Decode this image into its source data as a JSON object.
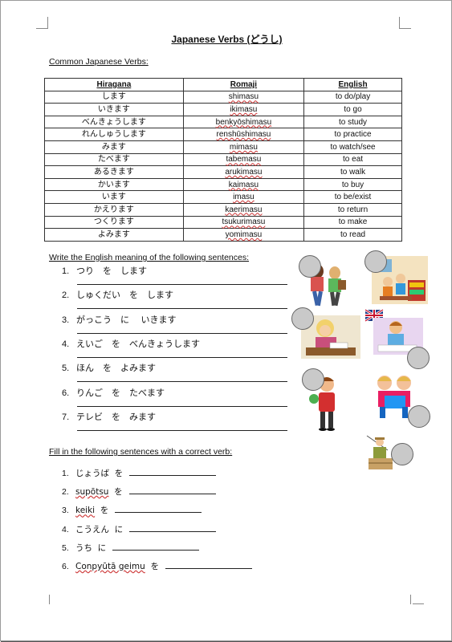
{
  "title": "Japanese Verbs (どうし)",
  "table_heading": "Common Japanese Verbs:",
  "table": {
    "headers": [
      "Hiragana",
      "Romaji",
      "English"
    ],
    "rows": [
      [
        "します",
        "shimasu",
        "to do/play"
      ],
      [
        "いきます",
        "ikimasu",
        "to go"
      ],
      [
        "べんきょうします",
        "benkyōshimasu",
        "to study"
      ],
      [
        "れんしゅうします",
        "renshūshimasu",
        "to practice"
      ],
      [
        "みます",
        "mimasu",
        "to watch/see"
      ],
      [
        "たべます",
        "tabemasu",
        "to eat"
      ],
      [
        "あるきます",
        "arukimasu",
        "to walk"
      ],
      [
        "かいます",
        "kaimasu",
        "to buy"
      ],
      [
        "います",
        "imasu",
        "to be/exist"
      ],
      [
        "かえります",
        "kaerimasu",
        "to return"
      ],
      [
        "つくります",
        "tsukurimasu",
        "to make"
      ],
      [
        "よみます",
        "yomimasu",
        "to read"
      ]
    ]
  },
  "translate_heading": "Write the English meaning of the following sentences:",
  "translate": [
    {
      "num": "1.",
      "text": "つり　を　します"
    },
    {
      "num": "2.",
      "text": "しゅくだい　を　します"
    },
    {
      "num": "3.",
      "text": "がっこう　に　 いきます"
    },
    {
      "num": "4.",
      "text": "えいご　を　べんきょうします"
    },
    {
      "num": "5.",
      "text": "ほん　を　よみます"
    },
    {
      "num": "6.",
      "text": "りんご　を　たべます"
    },
    {
      "num": "7.",
      "text": "テレビ　を　みます"
    }
  ],
  "fill_heading": "Fill in the following sentences with a correct verb:",
  "fill": [
    {
      "num": "1.",
      "word": "じょうば",
      "particle": "を"
    },
    {
      "num": "2.",
      "word": "supōtsu",
      "particle": "を"
    },
    {
      "num": "3.",
      "word": "keiki",
      "particle": "を"
    },
    {
      "num": "4.",
      "word": "こうえん",
      "particle": "に"
    },
    {
      "num": "5.",
      "word": "うち",
      "particle": "に"
    },
    {
      "num": "6.",
      "word": "Conpyūtā geimu",
      "particle": "を"
    }
  ]
}
